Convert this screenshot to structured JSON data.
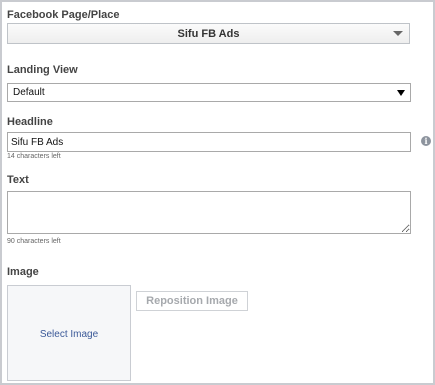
{
  "facebook_page": {
    "label": "Facebook Page/Place",
    "selected": "Sifu FB Ads",
    "icon": "chevron-down-icon"
  },
  "landing_view": {
    "label": "Landing View",
    "selected": "Default",
    "icon": "triangle-down-icon"
  },
  "headline": {
    "label": "Headline",
    "value": "Sifu FB Ads",
    "chars_left": "14 characters left",
    "info_icon": "info-icon",
    "info_glyph": "i"
  },
  "text": {
    "label": "Text",
    "value": "",
    "chars_left": "90 characters left"
  },
  "image": {
    "label": "Image",
    "select_label": "Select Image",
    "reposition_label": "Reposition Image"
  }
}
